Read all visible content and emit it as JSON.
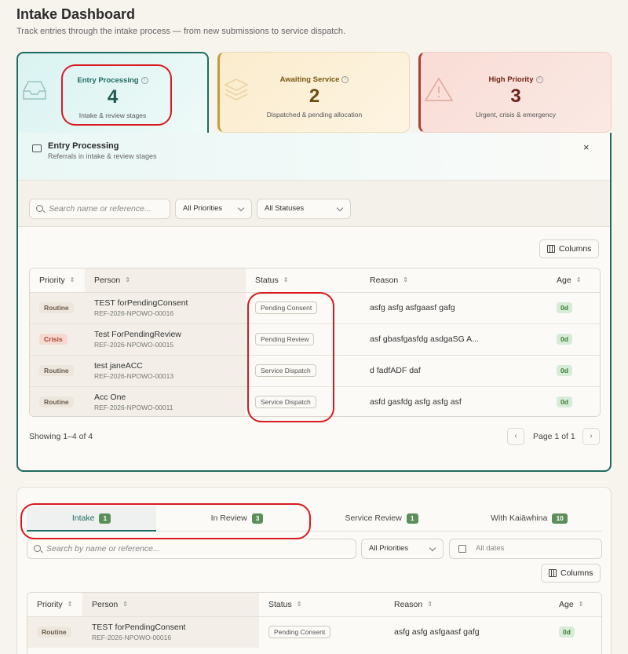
{
  "page": {
    "title": "Intake Dashboard",
    "subtitle": "Track entries through the intake process — from new submissions to service dispatch."
  },
  "cards": [
    {
      "label": "Entry Processing",
      "count": "4",
      "desc": "Intake & review stages"
    },
    {
      "label": "Awaiting Service",
      "count": "2",
      "desc": "Dispatched & pending allocation"
    },
    {
      "label": "High Priority",
      "count": "3",
      "desc": "Urgent, crisis & emergency"
    }
  ],
  "panel": {
    "title": "Entry Processing",
    "subtitle": "Referrals in intake & review stages",
    "close": "×",
    "search_placeholder": "Search name or reference...",
    "priority_filter": "All Priorities",
    "status_filter": "All Statuses",
    "columns_label": "Columns",
    "headers": [
      "Priority",
      "Person",
      "Status",
      "Reason",
      "Age"
    ],
    "rows": [
      {
        "priority": "Routine",
        "name": "TEST forPendingConsent",
        "ref": "REF-2026-NPOWO-00016",
        "status": "Pending Consent",
        "reason": "asfg asfg asfgaasf gafg",
        "age": "0d"
      },
      {
        "priority": "Crisis",
        "name": "Test ForPendingReview",
        "ref": "REF-2026-NPOWO-00015",
        "status": "Pending Review",
        "reason": "asf gbasfgasfdg asdgaSG A...",
        "age": "0d"
      },
      {
        "priority": "Routine",
        "name": "test janeACC",
        "ref": "REF-2026-NPOWO-00013",
        "status": "Service Dispatch",
        "reason": "d fadfADF daf",
        "age": "0d"
      },
      {
        "priority": "Routine",
        "name": "Acc One",
        "ref": "REF-2026-NPOWO-00011",
        "status": "Service Dispatch",
        "reason": "asfd gasfdg asfg asfg asf",
        "age": "0d"
      }
    ],
    "showing": "Showing 1–4 of 4",
    "page_label": "Page 1 of 1"
  },
  "panel2": {
    "tabs": [
      {
        "label": "Intake",
        "count": "1"
      },
      {
        "label": "In Review",
        "count": "3"
      },
      {
        "label": "Service Review",
        "count": "1"
      },
      {
        "label": "With Kaiāwhina",
        "count": "10"
      }
    ],
    "search_placeholder": "Search by name or reference...",
    "priority_filter": "All Priorities",
    "date_filter": "All dates",
    "columns_label": "Columns",
    "headers": [
      "Priority",
      "Person",
      "Status",
      "Reason",
      "Age"
    ],
    "rows": [
      {
        "priority": "Routine",
        "name": "TEST forPendingConsent",
        "ref": "REF-2026-NPOWO-00016",
        "status": "Pending Consent",
        "reason": "asfg asfg asfgaasf gafg",
        "age": "0d"
      }
    ]
  },
  "colors": {
    "teal": "#1f6b61",
    "amber": "#c59a3a",
    "rust": "#a8412f",
    "annotation": "#d9191f"
  }
}
